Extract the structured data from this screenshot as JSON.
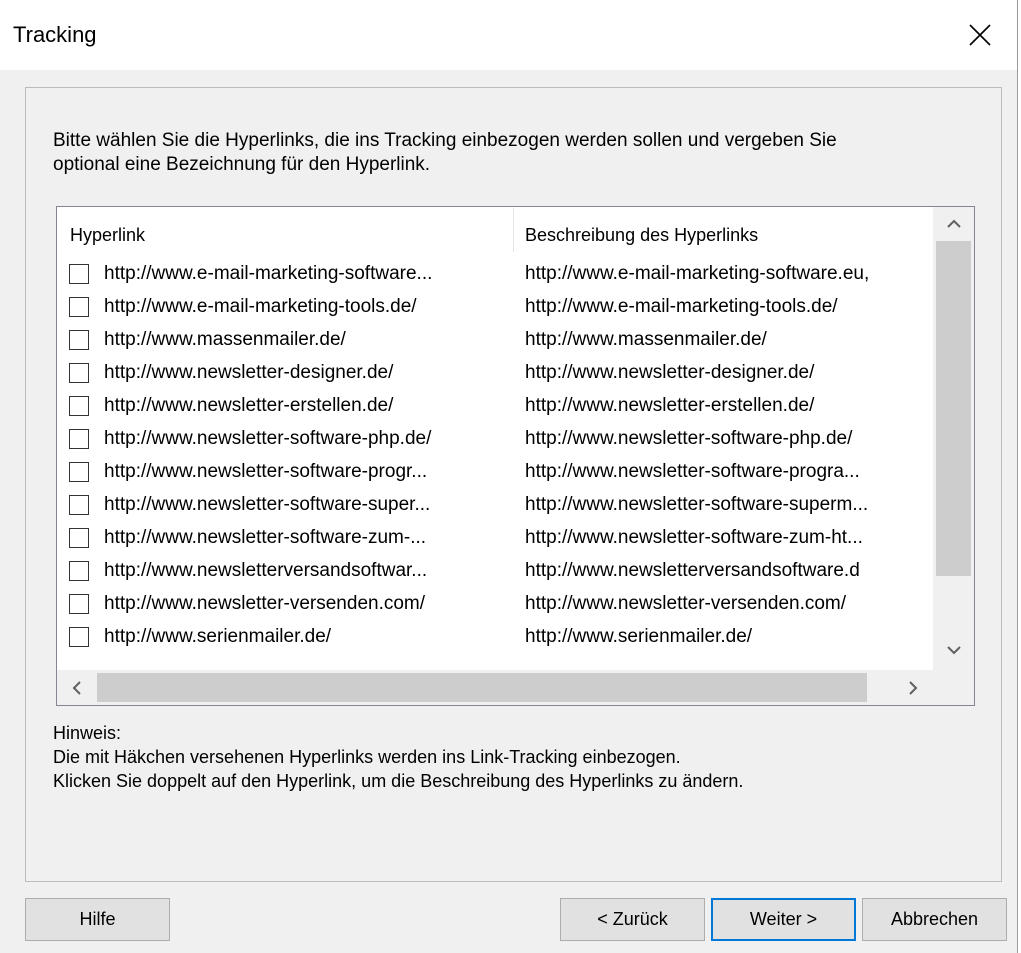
{
  "window": {
    "title": "Tracking"
  },
  "intro": {
    "line1": "Bitte wählen Sie die Hyperlinks, die ins Tracking einbezogen werden sollen und vergeben Sie",
    "line2": "optional eine Bezeichnung für den Hyperlink."
  },
  "table": {
    "columns": [
      "Hyperlink",
      "Beschreibung des Hyperlinks"
    ],
    "rows": [
      {
        "checked": false,
        "hyperlink": "http://www.e-mail-marketing-software...",
        "description": "http://www.e-mail-marketing-software.eu,"
      },
      {
        "checked": false,
        "hyperlink": "http://www.e-mail-marketing-tools.de/",
        "description": "http://www.e-mail-marketing-tools.de/"
      },
      {
        "checked": false,
        "hyperlink": "http://www.massenmailer.de/",
        "description": "http://www.massenmailer.de/"
      },
      {
        "checked": false,
        "hyperlink": "http://www.newsletter-designer.de/",
        "description": "http://www.newsletter-designer.de/"
      },
      {
        "checked": false,
        "hyperlink": "http://www.newsletter-erstellen.de/",
        "description": "http://www.newsletter-erstellen.de/"
      },
      {
        "checked": false,
        "hyperlink": "http://www.newsletter-software-php.de/",
        "description": "http://www.newsletter-software-php.de/"
      },
      {
        "checked": false,
        "hyperlink": "http://www.newsletter-software-progr...",
        "description": "http://www.newsletter-software-progra..."
      },
      {
        "checked": false,
        "hyperlink": "http://www.newsletter-software-super...",
        "description": "http://www.newsletter-software-superm..."
      },
      {
        "checked": false,
        "hyperlink": "http://www.newsletter-software-zum-...",
        "description": "http://www.newsletter-software-zum-ht..."
      },
      {
        "checked": false,
        "hyperlink": "http://www.newsletterversandsoftwar...",
        "description": "http://www.newsletterversandsoftware.d"
      },
      {
        "checked": false,
        "hyperlink": "http://www.newsletter-versenden.com/",
        "description": "http://www.newsletter-versenden.com/"
      },
      {
        "checked": false,
        "hyperlink": "http://www.serienmailer.de/",
        "description": "http://www.serienmailer.de/"
      }
    ]
  },
  "note": {
    "heading": "Hinweis:",
    "line1": "Die mit Häkchen versehenen Hyperlinks werden ins Link-Tracking einbezogen.",
    "line2": "Klicken Sie doppelt auf den Hyperlink, um die Beschreibung des Hyperlinks zu ändern."
  },
  "buttons": {
    "help": "Hilfe",
    "back": "< Zurück",
    "next": "Weiter >",
    "cancel": "Abbrechen"
  },
  "icons": {
    "close": "close-icon",
    "scroll_up": "chevron-up-icon",
    "scroll_down": "chevron-down-icon",
    "scroll_left": "chevron-left-icon",
    "scroll_right": "chevron-right-icon"
  },
  "colors": {
    "accent": "#0078d7",
    "dialog_bg": "#f0f0f0"
  }
}
